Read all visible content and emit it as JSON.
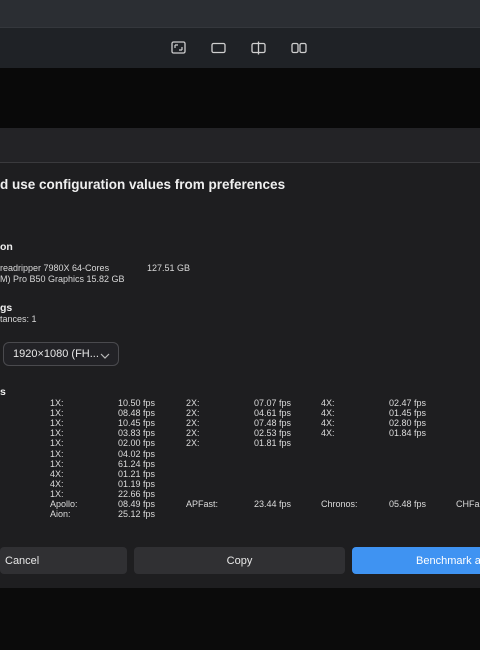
{
  "toolbar": {
    "icons": [
      "fullscreen-icon",
      "single-panel-icon",
      "split-panel-icon",
      "dual-panel-icon"
    ]
  },
  "dialog": {
    "heading": "d use configuration values from preferences",
    "system_section": "on",
    "system_lines": {
      "cpu": "readripper 7980X 64-Cores",
      "memory": "127.51 GB",
      "gpu": "M) Pro B50 Graphics  15.82 GB"
    },
    "settings_section": "gs",
    "instances_text": "tances: 1",
    "resolution_value": "1920×1080 (FH...",
    "results_section": "s",
    "results": {
      "rows": [
        {
          "c1": "1X:",
          "v1": "10.50 fps",
          "c2": "2X:",
          "v2": "07.07 fps",
          "c3": "4X:",
          "v3": "02.47 fps"
        },
        {
          "c1": "1X:",
          "v1": "08.48 fps",
          "c2": "2X:",
          "v2": "04.61 fps",
          "c3": "4X:",
          "v3": "01.45 fps"
        },
        {
          "c1": "1X:",
          "v1": "10.45 fps",
          "c2": "2X:",
          "v2": "07.48 fps",
          "c3": "4X:",
          "v3": "02.80 fps"
        },
        {
          "c1": "1X:",
          "v1": "03.83 fps",
          "c2": "2X:",
          "v2": "02.53 fps",
          "c3": "4X:",
          "v3": "01.84 fps"
        },
        {
          "c1": "1X:",
          "v1": "02.00 fps",
          "c2": "2X:",
          "v2": "01.81 fps",
          "c3": "",
          "v3": ""
        },
        {
          "c1": "1X:",
          "v1": "04.02 fps",
          "c2": "",
          "v2": "",
          "c3": "",
          "v3": ""
        },
        {
          "c1": "1X:",
          "v1": "61.24 fps",
          "c2": "",
          "v2": "",
          "c3": "",
          "v3": ""
        },
        {
          "c1": "4X:",
          "v1": "01.21 fps",
          "c2": "",
          "v2": "",
          "c3": "",
          "v3": ""
        },
        {
          "c1": "4X:",
          "v1": "01.19 fps",
          "c2": "",
          "v2": "",
          "c3": "",
          "v3": ""
        },
        {
          "c1": "1X:",
          "v1": "22.66 fps",
          "c2": "",
          "v2": "",
          "c3": "",
          "v3": ""
        },
        {
          "c1": "Apollo:",
          "v1": "08.49 fps",
          "c2": "APFast:",
          "v2": "23.44 fps",
          "c3": "Chronos:",
          "v3": "05.48 fps",
          "c4": "CHFa"
        },
        {
          "c1": "Aion:",
          "v1": "25.12 fps",
          "c2": "",
          "v2": "",
          "c3": "",
          "v3": ""
        }
      ]
    },
    "buttons": {
      "cancel": "Cancel",
      "copy": "Copy",
      "benchmark": "Benchmark a"
    }
  }
}
